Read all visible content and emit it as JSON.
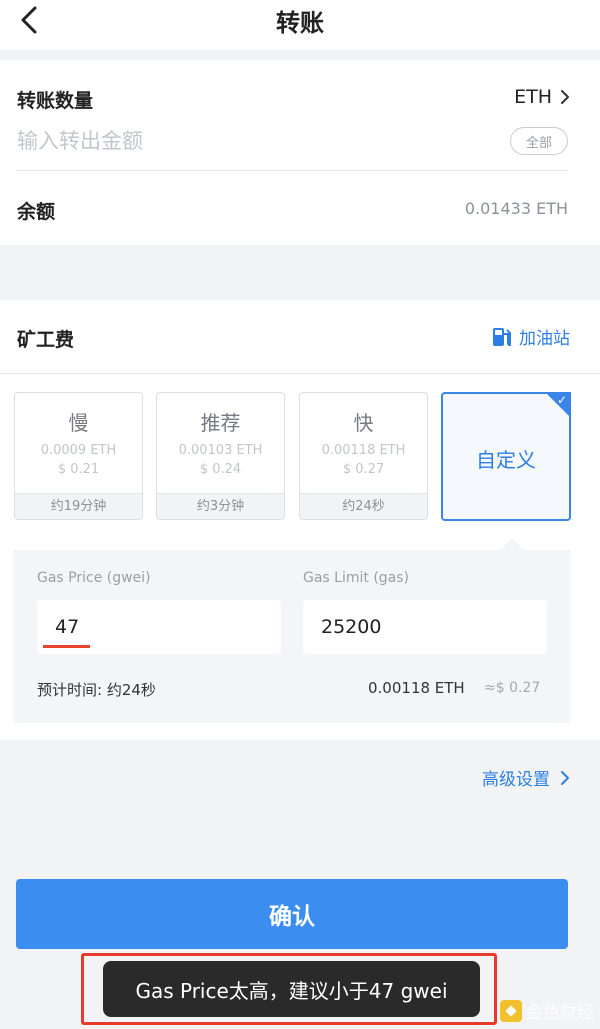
{
  "header": {
    "title": "转账"
  },
  "amount": {
    "label": "转账数量",
    "token": "ETH",
    "placeholder": "输入转出金额",
    "all_label": "全部"
  },
  "balance": {
    "label": "余额",
    "value": "0.01433 ETH"
  },
  "fee": {
    "label": "矿工费",
    "gas_station": "加油站",
    "options": [
      {
        "name": "慢",
        "eth": "0.0009 ETH",
        "usd": "$ 0.21",
        "time": "约19分钟"
      },
      {
        "name": "推荐",
        "eth": "0.00103 ETH",
        "usd": "$ 0.24",
        "time": "约3分钟"
      },
      {
        "name": "快",
        "eth": "0.00118 ETH",
        "usd": "$ 0.27",
        "time": "约24秒"
      }
    ],
    "custom_label": "自定义"
  },
  "custom": {
    "gas_price_label": "Gas Price (gwei)",
    "gas_price_value": "47",
    "gas_limit_label": "Gas Limit (gas)",
    "gas_limit_value": "25200",
    "est_time": "预计时间: 约24秒",
    "est_eth": "0.00118 ETH",
    "est_usd": "≈$ 0.27"
  },
  "advanced_label": "高级设置",
  "confirm_label": "确认",
  "toast": "Gas Price太高，建议小于47 gwei",
  "watermark": "金色财经",
  "colors": {
    "accent": "#3b8ef0",
    "link": "#2d7fe3",
    "warning": "#e53b2c"
  }
}
